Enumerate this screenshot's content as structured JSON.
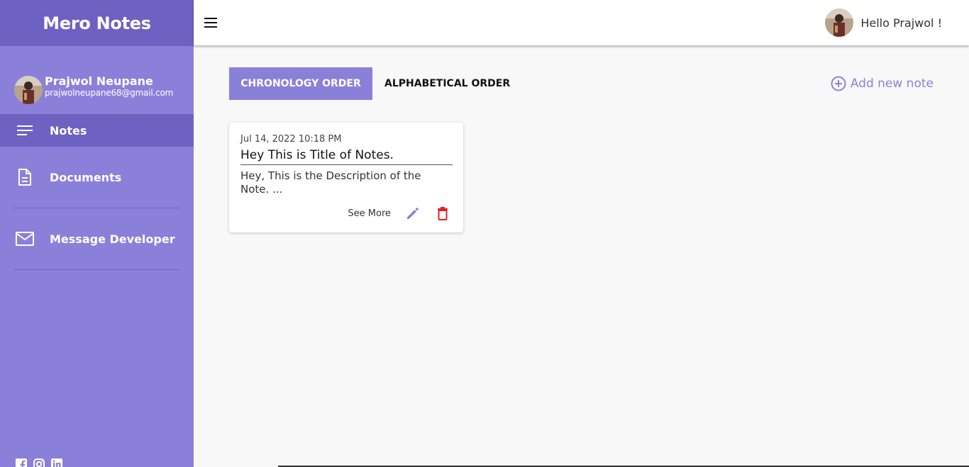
{
  "app": {
    "brand": "Mero Notes"
  },
  "user": {
    "name": "Prajwol Neupane",
    "email": "prajwolneupane68@gmail.com",
    "greeting": "Hello Prajwol !"
  },
  "sidebar": {
    "items": [
      {
        "label": "Notes",
        "icon": "notes-icon"
      },
      {
        "label": "Documents",
        "icon": "document-icon"
      },
      {
        "label": "Message Developer",
        "icon": "mail-icon"
      }
    ],
    "socials": [
      "facebook-icon",
      "instagram-icon",
      "linkedin-icon"
    ]
  },
  "toolbar": {
    "chronology": "CHRONOLOGY ORDER",
    "alphabetical": "ALPHABETICAL ORDER",
    "add_note": "Add new note"
  },
  "notes": [
    {
      "date": "Jul 14, 2022 10:18 PM",
      "title": "Hey This is Title of Notes.",
      "description": "Hey, This is the Description of the Note. ...",
      "see_more": "See More"
    }
  ],
  "colors": {
    "accent": "#8b80d9",
    "accent_dark": "#6d62c2",
    "danger": "#e02020"
  }
}
